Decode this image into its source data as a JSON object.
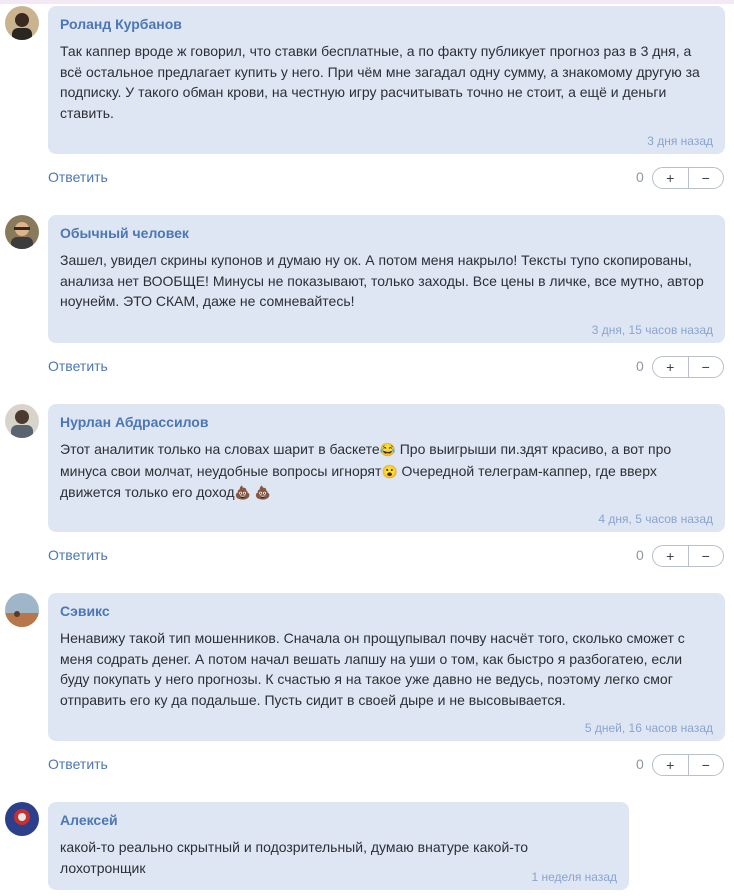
{
  "reply_label": "Ответить",
  "vote_plus": "+",
  "vote_minus": "−",
  "comments": [
    {
      "author": "Роланд Курбанов",
      "text": "Так каппер вроде ж говорил, что ставки бесплатные, а по факту публикует прогноз раз в 3 дня, а всё остальное предлагает купить у него. При чём мне загадал одну сумму, а знакомому другую за подписку. У такого обман крови, на честную игру расчитывать точно не стоит, а ещё и деньги ставить.",
      "time": "3 дня назад",
      "score": "0"
    },
    {
      "author": "Обычный человек",
      "text": "Зашел, увидел скрины купонов и думаю ну ок. А потом меня накрыло! Тексты тупо скопированы, анализа нет ВООБЩЕ! Минусы не показывают, только заходы. Все цены в личке, все мутно, автор ноунейм. ЭТО СКАМ, даже не сомневайтесь!",
      "time": "3 дня, 15 часов назад",
      "score": "0"
    },
    {
      "author": "Нурлан Абдрассилов",
      "text_parts": [
        "Этот аналитик только на словах шарит в баскете",
        " Про выигрыши пи.здят красиво, а вот про минуса свои молчат, неудобные вопросы игнорят",
        " Очередной телеграм-каппер, где вверх движется только его доход",
        " "
      ],
      "emojis": [
        "😂",
        "😮",
        "💩",
        "💩"
      ],
      "time": "4 дня, 5 часов назад",
      "score": "0"
    },
    {
      "author": "Сэвикс",
      "text": "Ненавижу такой тип мошенников. Сначала он прощупывал почву насчёт того, сколько сможет с меня содрать денег. А потом начал вешать лапшу на уши о том, как быстро я разбогатею, если буду покупать у него прогнозы. К счастью я на такое уже давно не ведусь, поэтому легко смог отправить его ку да подальше. Пусть сидит в своей дыре и не высовывается.",
      "time": "5 дней, 16 часов назад",
      "score": "0"
    },
    {
      "author": "Алексей",
      "text": "какой-то реально скрытный и подозрительный, думаю внатуре какой-то лохотронщик",
      "time": "1 неделя назад"
    }
  ]
}
